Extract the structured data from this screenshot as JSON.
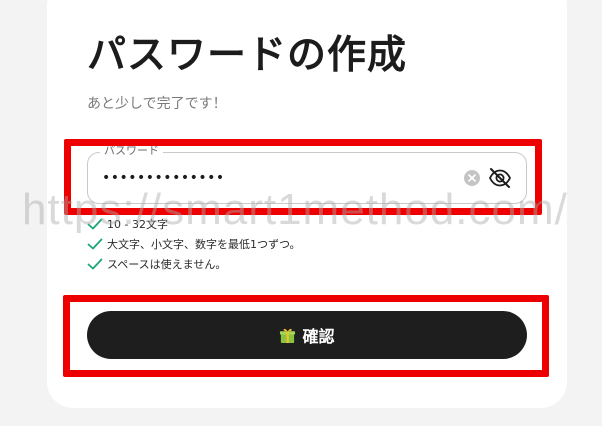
{
  "page": {
    "title": "パスワードの作成",
    "subtitle": "あと少しで完了です！"
  },
  "password_field": {
    "label": "パスワード",
    "value": "••••••••••••••",
    "clear_icon": "clear-circle-icon",
    "visibility_icon": "eye-off-icon"
  },
  "requirements": [
    {
      "text": "10 - 32文字",
      "met": true
    },
    {
      "text": "大文字、小文字、数字を最低1つずつ。",
      "met": true
    },
    {
      "text": "スペースは使えません。",
      "met": true
    }
  ],
  "confirm_button": {
    "label": "確認",
    "icon": "gift-icon"
  },
  "watermark": "https://smart1method.com/",
  "colors": {
    "highlight": "#ee0000",
    "check": "#1aa679",
    "button_bg": "#1e1e1e",
    "card_bg": "#ffffff",
    "page_bg": "#f3f3f3"
  }
}
